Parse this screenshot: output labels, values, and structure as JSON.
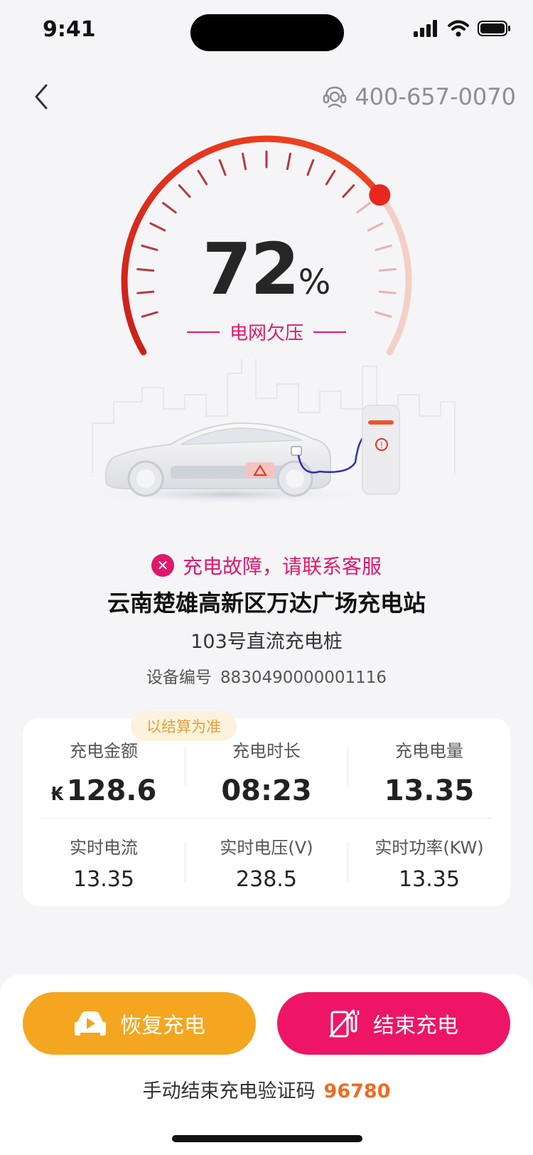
{
  "status_bar": {
    "time": "9:41"
  },
  "nav": {
    "hotline": "400-657-0070"
  },
  "gauge": {
    "percent": 72,
    "percent_text": "72",
    "percent_sign": "%",
    "status": "电网欠压"
  },
  "fault": {
    "icon": "close-icon",
    "message": "充电故障，请联系客服"
  },
  "station": {
    "name": "云南楚雄高新区万达广场充电站",
    "pile": "103号直流充电桩",
    "device_label": "设备编号",
    "device_no": "8830490000001116"
  },
  "stats": {
    "settle_tag": "以结算为准",
    "currency": "₭",
    "amount_label": "充电金额",
    "amount": "128.6",
    "duration_label": "充电时长",
    "duration": "08:23",
    "energy_label": "充电电量",
    "energy": "13.35",
    "current_label": "实时电流",
    "current": "13.35",
    "voltage_label": "实时电压(V)",
    "voltage": "238.5",
    "power_label": "实时功率(KW)",
    "power": "13.35"
  },
  "actions": {
    "resume_label": "恢复充电",
    "end_label": "结束充电",
    "verify_label": "手动结束充电验证码",
    "verify_code": "96780"
  },
  "colors": {
    "accent": "#ee1566",
    "warning": "#f4a620",
    "gauge": "#e0351e",
    "code": "#f06a22"
  }
}
